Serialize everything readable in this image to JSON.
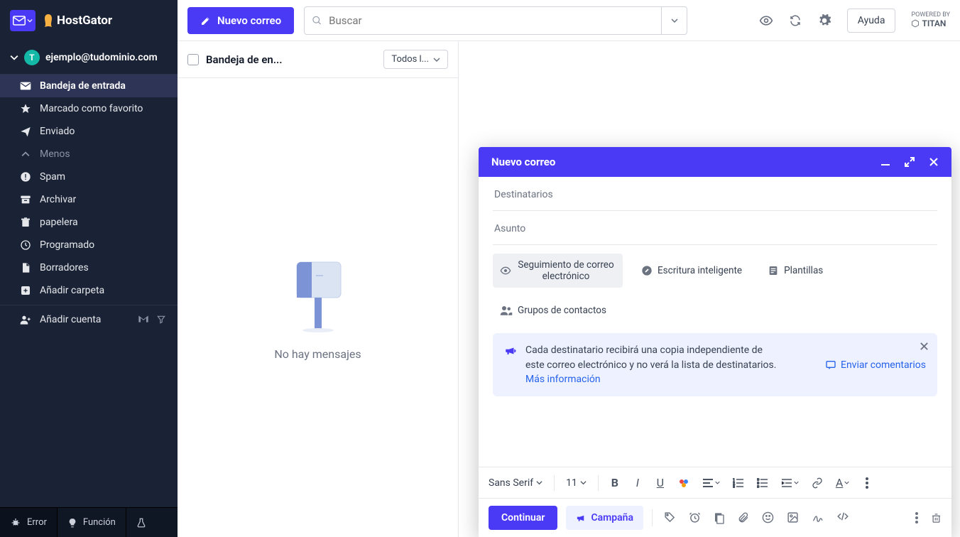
{
  "brand": {
    "name": "HostGator"
  },
  "header": {
    "compose": "Nuevo correo",
    "search_placeholder": "Buscar",
    "help": "Ayuda",
    "powered_by_label": "POWERED BY",
    "powered_by_name": "TITAN"
  },
  "sidebar": {
    "avatar_letter": "T",
    "email": "ejemplo@tudominio.com",
    "items": [
      {
        "label": "Bandeja de entrada",
        "icon": "inbox-icon",
        "active": true
      },
      {
        "label": "Marcado como favorito",
        "icon": "star-icon"
      },
      {
        "label": "Enviado",
        "icon": "send-icon"
      },
      {
        "label": "Menos",
        "icon": "chevron-up-icon",
        "less": true
      },
      {
        "label": "Spam",
        "icon": "alert-icon"
      },
      {
        "label": "Archivar",
        "icon": "archive-icon"
      },
      {
        "label": "papelera",
        "icon": "trash-icon"
      },
      {
        "label": "Programado",
        "icon": "clock-icon"
      },
      {
        "label": "Borradores",
        "icon": "draft-icon"
      },
      {
        "label": "Añadir carpeta",
        "icon": "plus-icon"
      }
    ],
    "add_account": "Añadir cuenta",
    "bottom": {
      "error": "Error",
      "feature": "Función"
    }
  },
  "list": {
    "title": "Bandeja de en...",
    "filter": "Todos l...",
    "empty": "No hay mensajes"
  },
  "compose": {
    "title": "Nuevo correo",
    "recipients_label": "Destinatarios",
    "subject_label": "Asunto",
    "chips": {
      "tracking": "Seguimiento de correo electrónico",
      "smart": "Escritura inteligente",
      "templates": "Plantillas",
      "groups": "Grupos de contactos"
    },
    "info_line1": "Cada destinatario recibirá una copia independiente de",
    "info_line2": "este correo electrónico y no verá la lista de destinatarios.",
    "more_info": "Más información",
    "feedback": "Enviar comentarios",
    "font_family": "Sans Serif",
    "font_size": "11",
    "continue": "Continuar",
    "campaign": "Campaña"
  }
}
